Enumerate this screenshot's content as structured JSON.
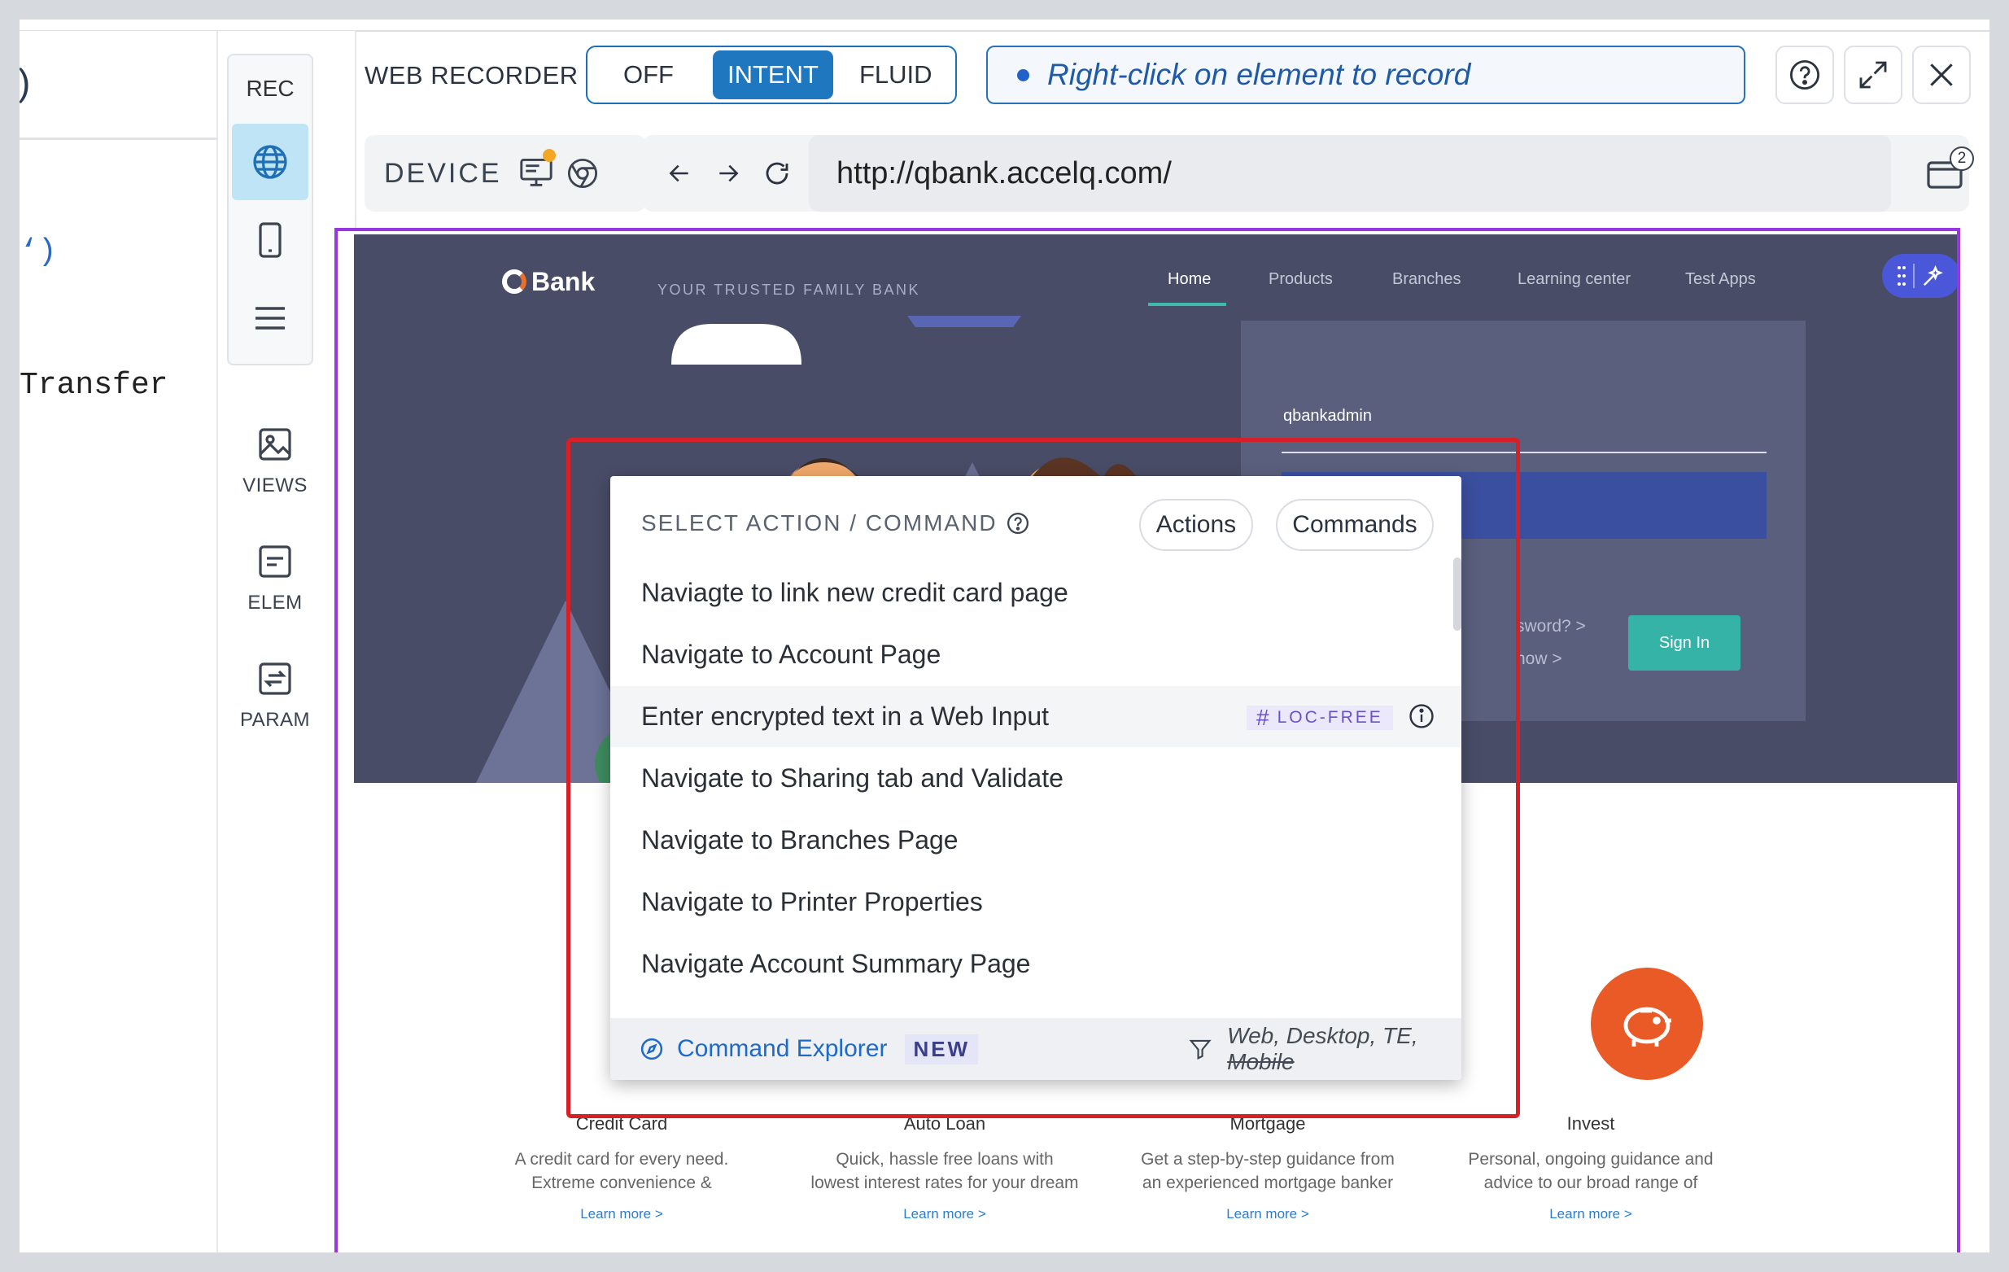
{
  "code": {
    "line1": "‘)",
    "line2": "Transfer"
  },
  "toolbar": {
    "rec_label": "REC",
    "views_label": "VIEWS",
    "elem_label": "ELEM",
    "param_label": "PARAM"
  },
  "recorder": {
    "title": "WEB RECORDER",
    "modes": [
      "OFF",
      "INTENT",
      "FLUID"
    ],
    "active_mode": "INTENT",
    "hint": "Right-click on element to record",
    "accent_color": "#1f78bf",
    "highlight_color": "#9a36e0"
  },
  "address": {
    "device_label": "DEVICE",
    "url": "http://qbank.accelq.com/",
    "tab_badge": "2"
  },
  "site": {
    "logo": "Bank",
    "tagline": "YOUR TRUSTED FAMILY BANK",
    "nav": [
      "Home",
      "Products",
      "Branches",
      "Learning center",
      "Test Apps"
    ],
    "username": "qbankadmin",
    "forgot_text": "sword?  >",
    "register_text": "now  >",
    "sign_in": "Sign In",
    "features": [
      {
        "title": "Credit Card",
        "desc": "A credit card for every need. Extreme convenience & unmatched benefits",
        "link": "Learn more  >"
      },
      {
        "title": "Auto Loan",
        "desc": "Quick, hassle free loans with lowest interest rates for your dream car",
        "link": "Learn more  >"
      },
      {
        "title": "Mortgage",
        "desc": "Get a step-by-step guidance from an experienced mortgage banker",
        "link": "Learn more  >"
      },
      {
        "title": "Invest",
        "desc": "Personal, ongoing guidance and advice to our broad range of products",
        "link": "Learn more  >"
      }
    ]
  },
  "popup": {
    "header": "SELECT ACTION / COMMAND",
    "actions_btn": "Actions",
    "commands_btn": "Commands",
    "items": [
      "Naviagte to link new credit card page",
      "Navigate to Account Page",
      "Enter encrypted text in a Web Input",
      "Navigate to Sharing tab and Validate",
      "Navigate to Branches Page",
      "Navigate to Printer Properties",
      "Navigate Account Summary Page"
    ],
    "loc_free_badge": "LOC-FREE",
    "footer_link": "Command Explorer",
    "footer_badge": "NEW",
    "platforms": "Web, Desktop, TE,",
    "platform_disabled": "Mobile"
  }
}
